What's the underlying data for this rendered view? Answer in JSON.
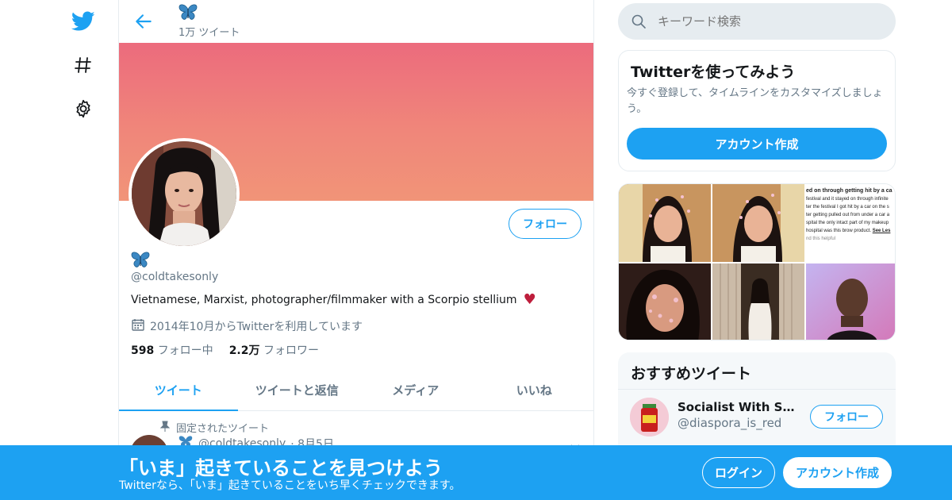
{
  "nav": {
    "logo_icon": "twitter-bird-icon",
    "explore_icon": "hash-icon",
    "settings_icon": "gear-icon"
  },
  "profile": {
    "display_name": "🦋",
    "tweet_count": "1万 ツイート",
    "handle": "@coldtakesonly",
    "bio": "Vietnamese, Marxist, photographer/filmmaker with a Scorpio stellium",
    "bio_emoji": "♥",
    "joined": "2014年10月からTwitterを利用しています",
    "following_count": "598",
    "following_label": "フォロー中",
    "followers_count": "2.2万",
    "followers_label": "フォロワー",
    "follow_label": "フォロー"
  },
  "tabs": [
    {
      "label": "ツイート",
      "active": true
    },
    {
      "label": "ツイートと返信",
      "active": false
    },
    {
      "label": "メディア",
      "active": false
    },
    {
      "label": "いいね",
      "active": false
    }
  ],
  "pinned_tweet": {
    "pinned_label": "固定されたツイート",
    "author_handle": "@coldtakesonly",
    "date": "· 8月5日"
  },
  "search": {
    "placeholder": "キーワード検索"
  },
  "signup_card": {
    "title": "Twitterを使ってみよう",
    "description": "今すぐ登録して、タイムラインをカスタマイズしましょう。",
    "button": "アカウント作成"
  },
  "media_text_snippet": {
    "line1": "ed on through getting hit by a ca",
    "line2": "festival and it stayed on through infinite",
    "line3": "ter the festival I got hit by a car on the s",
    "line4": "ter getting pulled out from under a car a",
    "line5": "spital the only intact part of my makeup",
    "line6": "hospital was this brow product.",
    "see_less": "See Les",
    "helpful": "nd this helpful"
  },
  "suggested": {
    "title": "おすすめツイート",
    "items": [
      {
        "name": "Socialist With SE Asi...",
        "handle": "@diaspora_is_red",
        "follow_label": "フォロー"
      }
    ]
  },
  "bottombar": {
    "title": "「いま」起きていることを見つけよう",
    "subtitle": "Twitterなら、「いま」起きていることをいち早くチェックできます。",
    "login": "ログイン",
    "signup": "アカウント作成"
  },
  "colors": {
    "accent": "#1da1f2",
    "banner_top": "#ec6b7d",
    "banner_bottom": "#f19478",
    "heart": "#be1e3c"
  }
}
